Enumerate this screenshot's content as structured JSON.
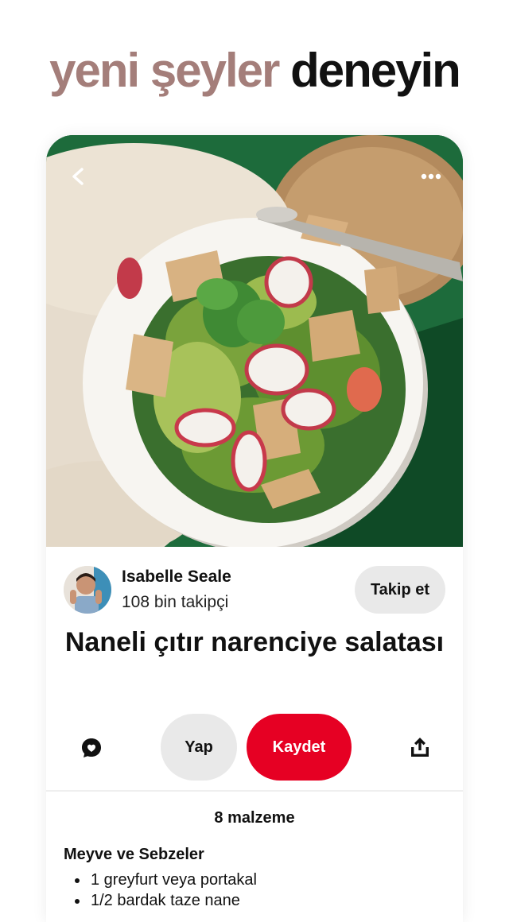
{
  "headline": {
    "accent": "yeni şeyler",
    "dark": "deneyin"
  },
  "pin": {
    "author": {
      "name": "Isabelle Seale",
      "followers": "108 bin takipçi",
      "follow_label": "Takip et"
    },
    "title": "Naneli çıtır narenciye salatası",
    "actions": {
      "make_label": "Yap",
      "save_label": "Kaydet"
    },
    "ingredients": {
      "count_label": "8 malzeme",
      "section_title": "Meyve ve Sebzeler",
      "items": [
        "1 greyfurt veya portakal",
        "1/2 bardak taze nane"
      ]
    }
  },
  "icons": {
    "back": "chevron-left-icon",
    "more": "more-dots-icon",
    "comment": "comment-bubble-icon",
    "share": "share-upload-icon"
  },
  "colors": {
    "accent": "#a47e7a",
    "save_red": "#e60023",
    "neutral_button": "#e9e9e9"
  }
}
